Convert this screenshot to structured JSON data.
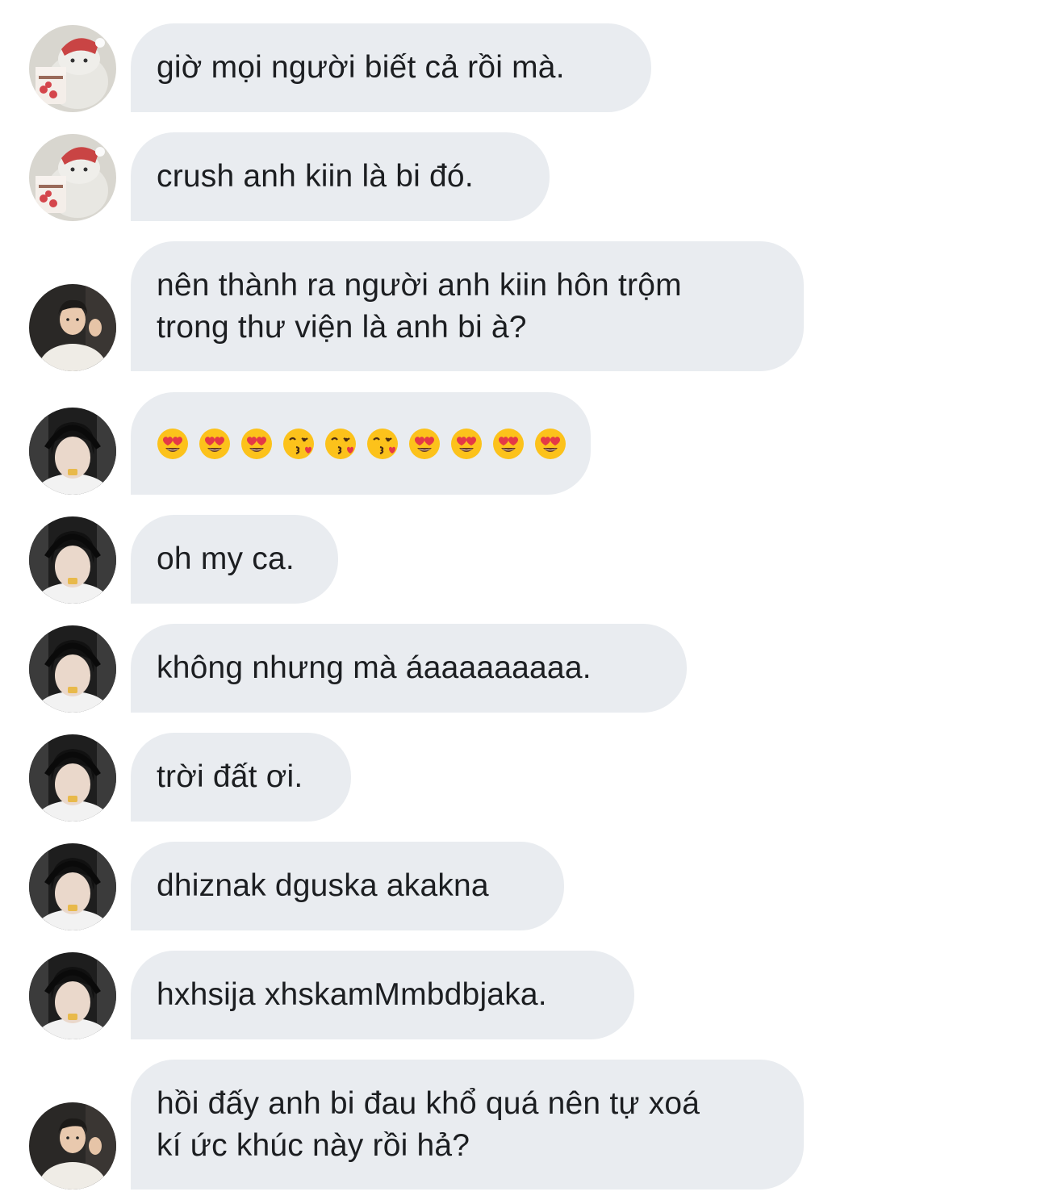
{
  "conversation": {
    "messages": [
      {
        "sender": "bear",
        "lines": [
          "giờ mọi người biết cả rồi mà."
        ]
      },
      {
        "sender": "bear",
        "lines": [
          "crush anh kiin là bi đó."
        ]
      },
      {
        "sender": "man",
        "lines": [
          "nên thành ra người anh kiin hôn trộm",
          "trong thư viện là anh bi à?"
        ]
      },
      {
        "sender": "boy",
        "emojis": [
          "heart-eyes-emoji",
          "heart-eyes-emoji",
          "heart-eyes-emoji",
          "kiss-heart-emoji",
          "kiss-heart-emoji",
          "kiss-heart-emoji",
          "heart-eyes-emoji",
          "heart-eyes-emoji",
          "heart-eyes-emoji",
          "heart-eyes-emoji"
        ]
      },
      {
        "sender": "boy",
        "lines": [
          "oh my ca."
        ]
      },
      {
        "sender": "boy",
        "lines": [
          "không nhưng mà áaaaaaaaaa."
        ]
      },
      {
        "sender": "boy",
        "lines": [
          "trời đất ơi."
        ]
      },
      {
        "sender": "boy",
        "lines": [
          "dhiznak dguska akakna"
        ]
      },
      {
        "sender": "boy",
        "lines": [
          "hxhsija xhskamMmbdbjaka."
        ]
      },
      {
        "sender": "man",
        "lines": [
          "hồi đấy anh bi đau khổ quá nên tự xoá",
          "kí ức khúc này rồi hả?"
        ]
      }
    ]
  },
  "colors": {
    "bubble": "#e9ecf0",
    "text": "#1c1e21",
    "background": "#ffffff"
  }
}
